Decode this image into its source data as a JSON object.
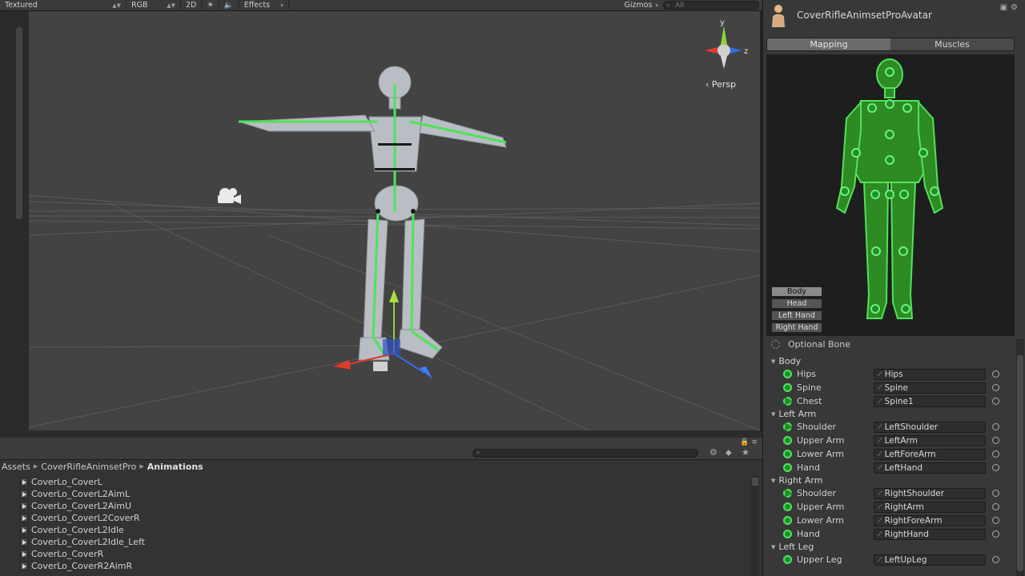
{
  "scene": {
    "toolbar": {
      "shading": "Textured",
      "channel": "RGB",
      "mode_2d": "2D",
      "effects": "Effects",
      "gizmos": "Gizmos",
      "search_placeholder": "All"
    },
    "gizmo_axes": {
      "y": "y",
      "z": "z"
    },
    "projection": "Persp"
  },
  "project": {
    "breadcrumb": [
      "Assets",
      "CoverRifleAnimsetPro",
      "Animations"
    ],
    "files": [
      "CoverLo_CoverL",
      "CoverLo_CoverL2AimL",
      "CoverLo_CoverL2AimU",
      "CoverLo_CoverL2CoverR",
      "CoverLo_CoverL2Idle",
      "CoverLo_CoverL2Idle_Left",
      "CoverLo_CoverR",
      "CoverLo_CoverR2AimR"
    ]
  },
  "avatar": {
    "title": "CoverRifleAnimsetProAvatar",
    "tabs": [
      {
        "label": "Mapping",
        "active": true
      },
      {
        "label": "Muscles",
        "active": false
      }
    ],
    "body_parts": [
      {
        "label": "Body",
        "active": true
      },
      {
        "label": "Head",
        "active": false
      },
      {
        "label": "Left Hand",
        "active": false
      },
      {
        "label": "Right Hand",
        "active": false
      }
    ],
    "optional_bone_label": "Optional Bone",
    "groups": [
      {
        "title": "Body",
        "bones": [
          {
            "name": "Hips",
            "value": "Hips",
            "optional": false
          },
          {
            "name": "Spine",
            "value": "Spine",
            "optional": false
          },
          {
            "name": "Chest",
            "value": "Spine1",
            "optional": true
          }
        ]
      },
      {
        "title": "Left Arm",
        "bones": [
          {
            "name": "Shoulder",
            "value": "LeftShoulder",
            "optional": true
          },
          {
            "name": "Upper Arm",
            "value": "LeftArm",
            "optional": false
          },
          {
            "name": "Lower Arm",
            "value": "LeftForeArm",
            "optional": false
          },
          {
            "name": "Hand",
            "value": "LeftHand",
            "optional": false
          }
        ]
      },
      {
        "title": "Right Arm",
        "bones": [
          {
            "name": "Shoulder",
            "value": "RightShoulder",
            "optional": true
          },
          {
            "name": "Upper Arm",
            "value": "RightArm",
            "optional": false
          },
          {
            "name": "Lower Arm",
            "value": "RightForeArm",
            "optional": false
          },
          {
            "name": "Hand",
            "value": "RightHand",
            "optional": false
          }
        ]
      },
      {
        "title": "Left Leg",
        "bones": [
          {
            "name": "Upper Leg",
            "value": "LeftUpLeg",
            "optional": false
          }
        ]
      }
    ]
  },
  "colors": {
    "bone_green": "#4fe35a",
    "axis_x": "#e03a2a",
    "axis_y": "#8fd43a",
    "axis_z": "#2f6fe8"
  }
}
